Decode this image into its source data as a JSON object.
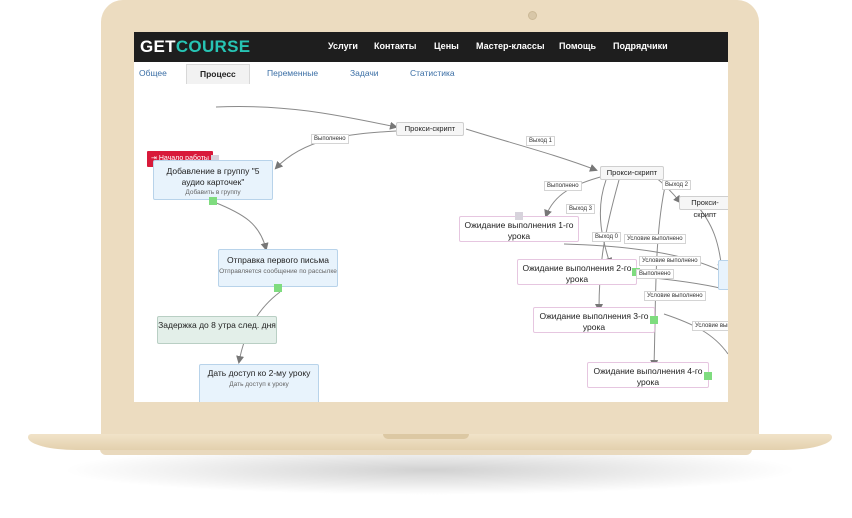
{
  "brand": {
    "logo_part1": "GET",
    "logo_part2": "COURSE",
    "accent": "#27c4b4"
  },
  "nav": [
    "Услуги",
    "Контакты",
    "Цены",
    "Мастер-классы",
    "Помощь",
    "Подрядчики"
  ],
  "tabs": [
    "Общее",
    "Процесс",
    "Переменные",
    "Задачи",
    "Статистика"
  ],
  "active_tab": "Процесс",
  "flow": {
    "start": "Начало работы",
    "proxy1": "Прокси-скрипт",
    "proxy2": "Прокси-скрипт",
    "proxy3": "Прокси-скрипт",
    "add_group": {
      "title": "Добавление в группу \"5 аудио карточек\"",
      "sub": "Добавить в группу"
    },
    "send_mail": {
      "title": "Отправка первого письма",
      "sub": "Отправляется сообщение по рассылке"
    },
    "delay": {
      "title": "Задержка до 8 утра след. дня"
    },
    "give_access": {
      "title": "Дать доступ ко 2-му уроку",
      "sub": "Дать доступ к уроку"
    },
    "wait1": "Ожидание выполнения 1-го урока",
    "wait2": "Ожидание выполнения 2-го урока",
    "wait3": "Ожидание выполнения 3-го урока",
    "wait4": "Ожидание выполнения 4-го урока",
    "labels": {
      "done1": "Выполнено",
      "exit1": "Выход 1",
      "done2": "Выполнено",
      "exit3": "Выход 3",
      "exit2": "Выход 2",
      "exit0": "Выход 0",
      "cond1": "Условие выполнено",
      "done3": "Выполнено",
      "cond2": "Условие выполнено",
      "cond3": "Условие выполнено",
      "cond4": "Условие выполнено"
    }
  }
}
